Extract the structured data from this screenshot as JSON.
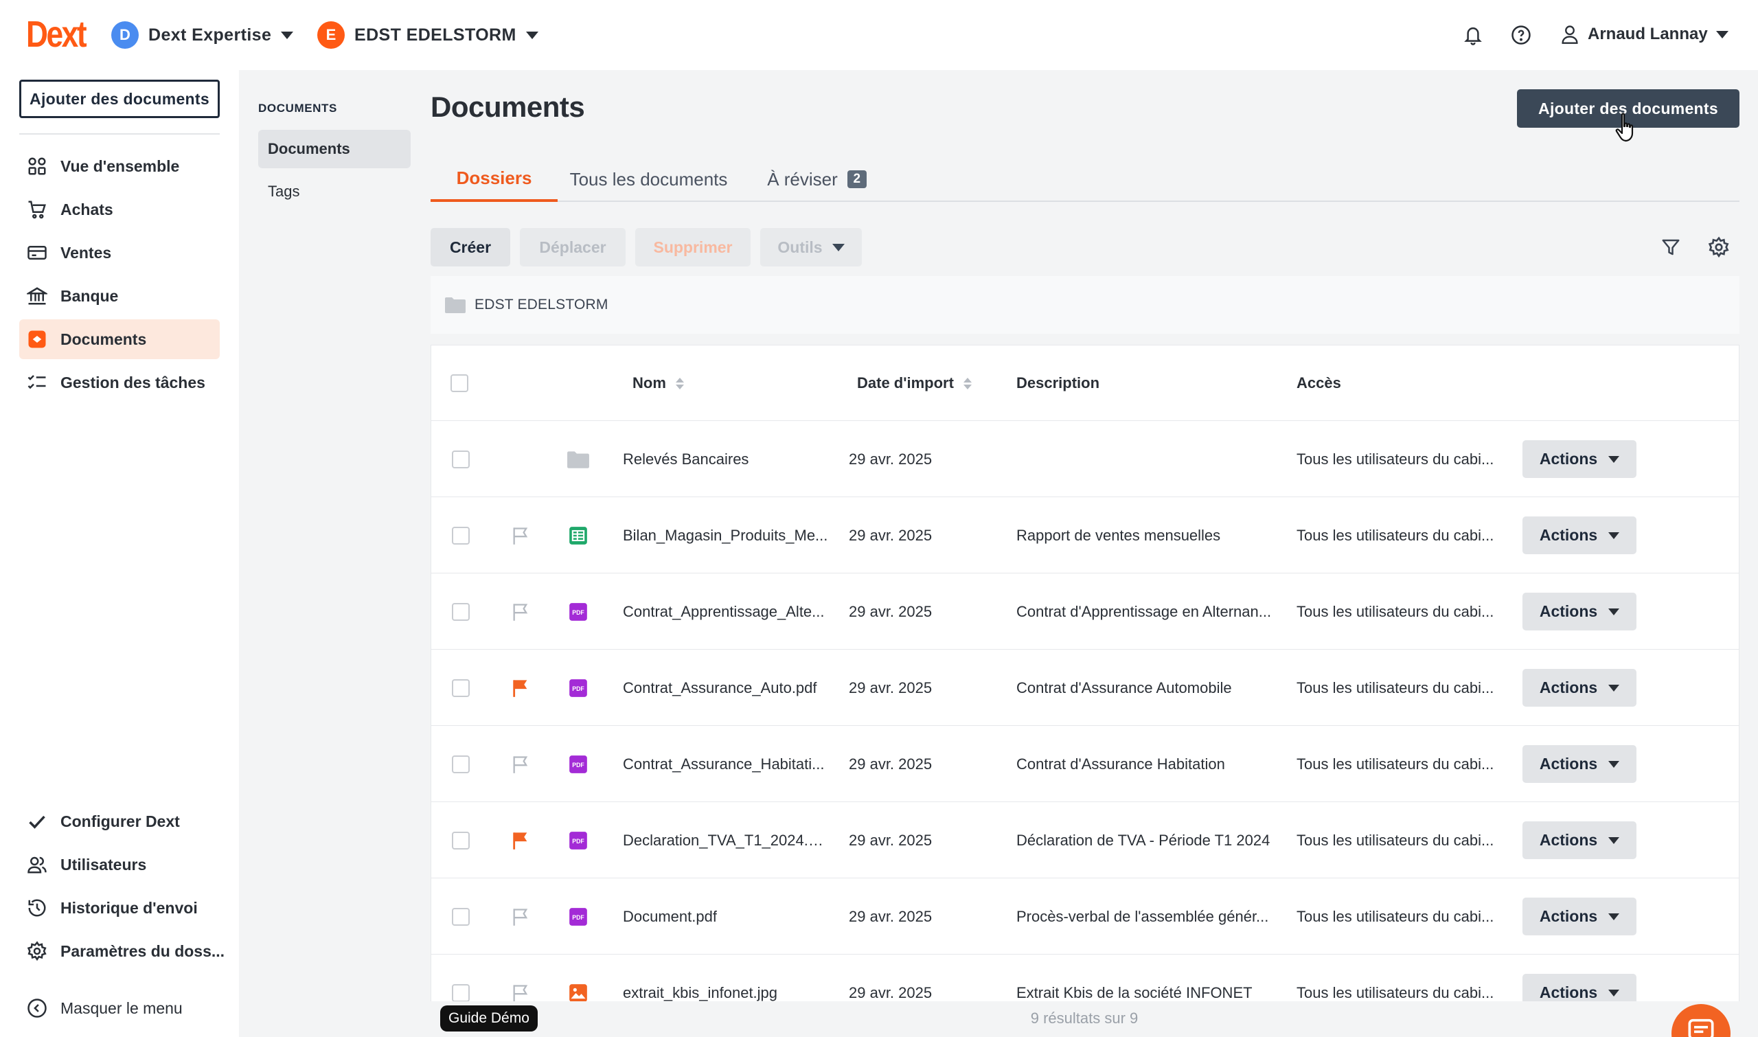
{
  "brand": {
    "logo_text": "Dext",
    "accent_color": "#ff5a14"
  },
  "topbar": {
    "org": {
      "initial": "D",
      "name": "Dext Expertise",
      "color": "#4a8cf0"
    },
    "client": {
      "initial": "E",
      "name": "EDST EDELSTORM",
      "color": "#ff5a14"
    },
    "user_name": "Arnaud Lannay",
    "icons": [
      "bell-icon",
      "help-icon",
      "user-icon"
    ]
  },
  "sidebar": {
    "add_button": "Ajouter des documents",
    "items": [
      {
        "label": "Vue d'ensemble",
        "icon": "overview-grid-icon"
      },
      {
        "label": "Achats",
        "icon": "cart-icon"
      },
      {
        "label": "Ventes",
        "icon": "card-icon"
      },
      {
        "label": "Banque",
        "icon": "bank-icon"
      },
      {
        "label": "Documents",
        "icon": "documents-icon",
        "active": true
      },
      {
        "label": "Gestion des tâches",
        "icon": "tasks-icon"
      }
    ],
    "bottom_items": [
      {
        "label": "Configurer Dext",
        "icon": "check-icon"
      },
      {
        "label": "Utilisateurs",
        "icon": "users-icon"
      },
      {
        "label": "Historique d'envoi",
        "icon": "history-icon"
      },
      {
        "label": "Paramètres du doss...",
        "icon": "settings-icon"
      }
    ],
    "collapse_label": "Masquer le menu"
  },
  "subnav": {
    "heading": "DOCUMENTS",
    "items": [
      {
        "label": "Documents",
        "active": true
      },
      {
        "label": "Tags"
      }
    ]
  },
  "main": {
    "title": "Documents",
    "add_button": "Ajouter des documents",
    "tabs": [
      {
        "label": "Dossiers",
        "active": true
      },
      {
        "label": "Tous les documents"
      },
      {
        "label": "À réviser",
        "badge": "2"
      }
    ],
    "toolbar": {
      "create": "Créer",
      "move": "Déplacer",
      "delete": "Supprimer",
      "tools": "Outils"
    },
    "breadcrumb": "EDST EDELSTORM",
    "table": {
      "headers": {
        "name": "Nom",
        "date": "Date d'import",
        "description": "Description",
        "access": "Accès"
      },
      "action_label": "Actions",
      "rows": [
        {
          "type": "folder",
          "flag": "none",
          "name": "Relevés Bancaires",
          "date": "29 avr. 2025",
          "description": "",
          "access": "Tous les utilisateurs du cabi..."
        },
        {
          "type": "sheet",
          "flag": "outline",
          "name": "Bilan_Magasin_Produits_Me...",
          "date": "29 avr. 2025",
          "description": "Rapport de ventes mensuelles",
          "access": "Tous les utilisateurs du cabi..."
        },
        {
          "type": "pdf",
          "flag": "outline",
          "name": "Contrat_Apprentissage_Alte...",
          "date": "29 avr. 2025",
          "description": "Contrat d'Apprentissage en Alternan...",
          "access": "Tous les utilisateurs du cabi..."
        },
        {
          "type": "pdf",
          "flag": "filled",
          "name": "Contrat_Assurance_Auto.pdf",
          "date": "29 avr. 2025",
          "description": "Contrat d'Assurance Automobile",
          "access": "Tous les utilisateurs du cabi..."
        },
        {
          "type": "pdf",
          "flag": "outline",
          "name": "Contrat_Assurance_Habitati...",
          "date": "29 avr. 2025",
          "description": "Contrat d'Assurance Habitation",
          "access": "Tous les utilisateurs du cabi..."
        },
        {
          "type": "pdf",
          "flag": "filled",
          "name": "Declaration_TVA_T1_2024.p...",
          "date": "29 avr. 2025",
          "description": "Déclaration de TVA - Période T1 2024",
          "access": "Tous les utilisateurs du cabi..."
        },
        {
          "type": "pdf",
          "flag": "outline",
          "name": "Document.pdf",
          "date": "29 avr. 2025",
          "description": "Procès-verbal de l'assemblée génér...",
          "access": "Tous les utilisateurs du cabi..."
        },
        {
          "type": "image",
          "flag": "outline",
          "name": "extrait_kbis_infonet.jpg",
          "date": "29 avr. 2025",
          "description": "Extrait Kbis de la société INFONET",
          "access": "Tous les utilisateurs du cabi..."
        }
      ]
    },
    "results_count": "9 résultats sur 9"
  },
  "guide_demo": "Guide Démo",
  "colors": {
    "pdf_icon": "#a32bd6",
    "sheet_icon": "#1fa86a",
    "image_icon": "#f26322",
    "flag_active": "#f26322",
    "primary_dark": "#3b4857"
  }
}
